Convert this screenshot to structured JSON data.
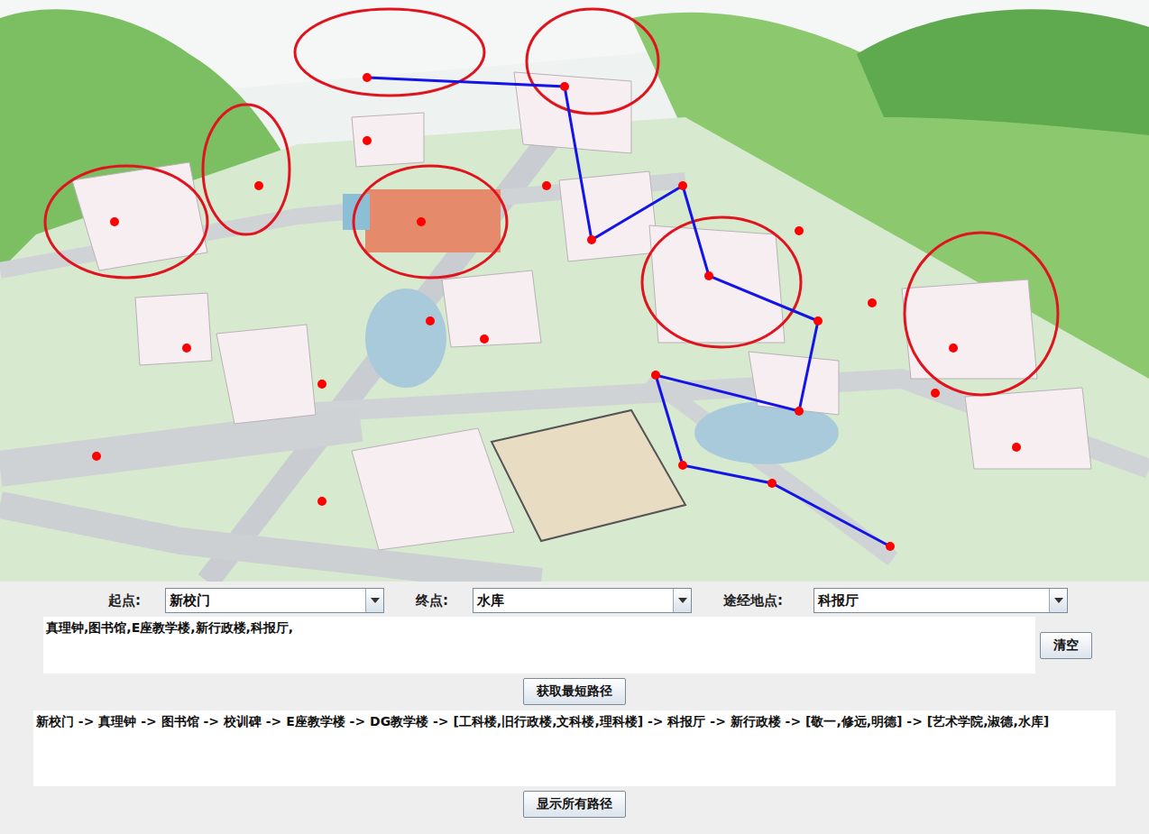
{
  "map": {
    "pin_count": 27,
    "route": [
      25,
      24,
      23,
      18,
      19,
      11,
      10,
      8,
      7,
      1,
      0
    ]
  },
  "form": {
    "start": {
      "label": "起点:",
      "value": "新校门"
    },
    "end": {
      "label": "终点:",
      "value": "水库"
    },
    "via": {
      "label": "途经地点:",
      "value": "科报厅"
    },
    "via_list": "真理钟,图书馆,E座教学楼,新行政楼,科报厅,",
    "clear_button": "清空",
    "shortest_button": "获取最短路径",
    "result": "新校门 -> 真理钟 -> 图书馆 -> 校训碑 -> E座教学楼 -> DG教学楼 -> [工科楼,旧行政楼,文科楼,理科楼] -> 科报厅 -> 新行政楼 -> [敬一,修远,明德] -> [艺术学院,淑德,水库]",
    "all_button": "显示所有路径"
  }
}
